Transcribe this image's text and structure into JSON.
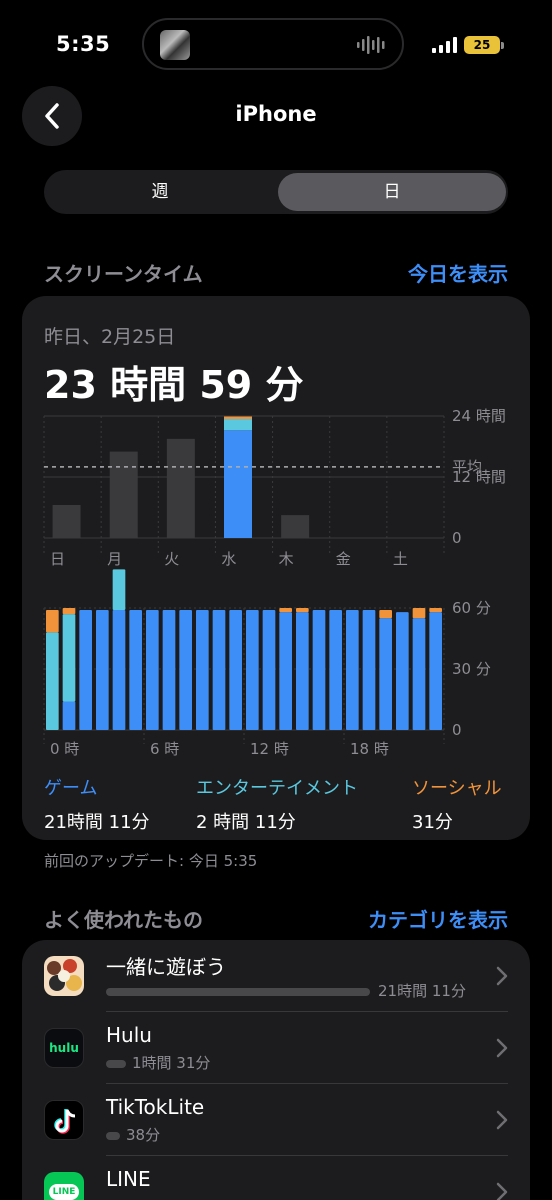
{
  "status_bar": {
    "time": "5:35",
    "battery": "25"
  },
  "nav": {
    "title": "iPhone"
  },
  "segment": {
    "week_label": "週",
    "day_label": "日"
  },
  "screen_time": {
    "section_title": "スクリーンタイム",
    "show_today_link": "今日を表示",
    "date": "昨日、2月25日",
    "total": "23 時間 59 分",
    "update_note": "前回のアップデート: 今日 5:35"
  },
  "categories": [
    {
      "name": "ゲーム",
      "value": "21時間 11分",
      "color": "#3e8ef7"
    },
    {
      "name": "エンターテイメント",
      "value": "2 時間 11分",
      "color": "#5ac8df"
    },
    {
      "name": "ソーシャル",
      "value": "31分",
      "color": "#f0933a"
    }
  ],
  "chart_data": [
    {
      "type": "bar",
      "categories": [
        "日",
        "月",
        "火",
        "水",
        "木",
        "金",
        "土"
      ],
      "values": [
        6.5,
        17,
        19.5,
        24,
        4.5,
        0,
        0
      ],
      "highlight_index": 3,
      "highlight_segments": [
        {
          "name": "ゲーム",
          "value": 21.2,
          "color": "#3e8ef7"
        },
        {
          "name": "エンターテイメント",
          "value": 2.2,
          "color": "#5ac8df"
        },
        {
          "name": "ソーシャル",
          "value": 0.5,
          "color": "#f0933a"
        }
      ],
      "y_tick_labels": [
        "24 時間",
        "12 時間",
        "0"
      ],
      "average_label": "平均",
      "average_value": 14,
      "ylim": [
        0,
        24
      ],
      "grid": true
    },
    {
      "type": "bar",
      "x_tick_labels": [
        "0 時",
        "6 時",
        "12 時",
        "18 時"
      ],
      "y_tick_labels": [
        "60 分",
        "30 分",
        "0"
      ],
      "ylim": [
        0,
        60
      ],
      "grid": true,
      "series": [
        {
          "name": "ゲーム",
          "color": "#3e8ef7",
          "values": [
            0,
            14,
            59,
            59,
            59,
            59,
            59,
            59,
            59,
            59,
            59,
            59,
            59,
            59,
            58,
            58,
            59,
            59,
            59,
            59,
            55,
            58,
            55,
            58
          ]
        },
        {
          "name": "エンターテイメント",
          "color": "#5ac8df",
          "values": [
            48,
            43,
            0,
            0,
            20,
            0,
            0,
            0,
            0,
            0,
            0,
            0,
            0,
            0,
            0,
            0,
            0,
            0,
            0,
            0,
            0,
            0,
            0,
            0
          ]
        },
        {
          "name": "ソーシャル",
          "color": "#f0933a",
          "values": [
            11,
            3,
            0,
            0,
            0,
            0,
            0,
            0,
            0,
            0,
            0,
            0,
            0,
            0,
            2,
            2,
            0,
            0,
            0,
            0,
            4,
            0,
            5,
            2
          ]
        }
      ]
    }
  ],
  "most_used": {
    "section_title": "よく使われたもの",
    "show_categories_link": "カテゴリを表示",
    "apps": [
      {
        "name": "一緒に遊ぼう",
        "time": "21時間 11分",
        "minutes": 1271,
        "icon": "game-app-icon"
      },
      {
        "name": "Hulu",
        "time": "1時間 31分",
        "minutes": 91,
        "icon": "hulu-icon",
        "icon_text": "hulu"
      },
      {
        "name": "TikTokLite",
        "time": "38分",
        "minutes": 38,
        "icon": "tiktok-icon"
      },
      {
        "name": "LINE",
        "time": "",
        "minutes": 0,
        "icon": "line-icon",
        "icon_text": "LINE"
      }
    ]
  }
}
